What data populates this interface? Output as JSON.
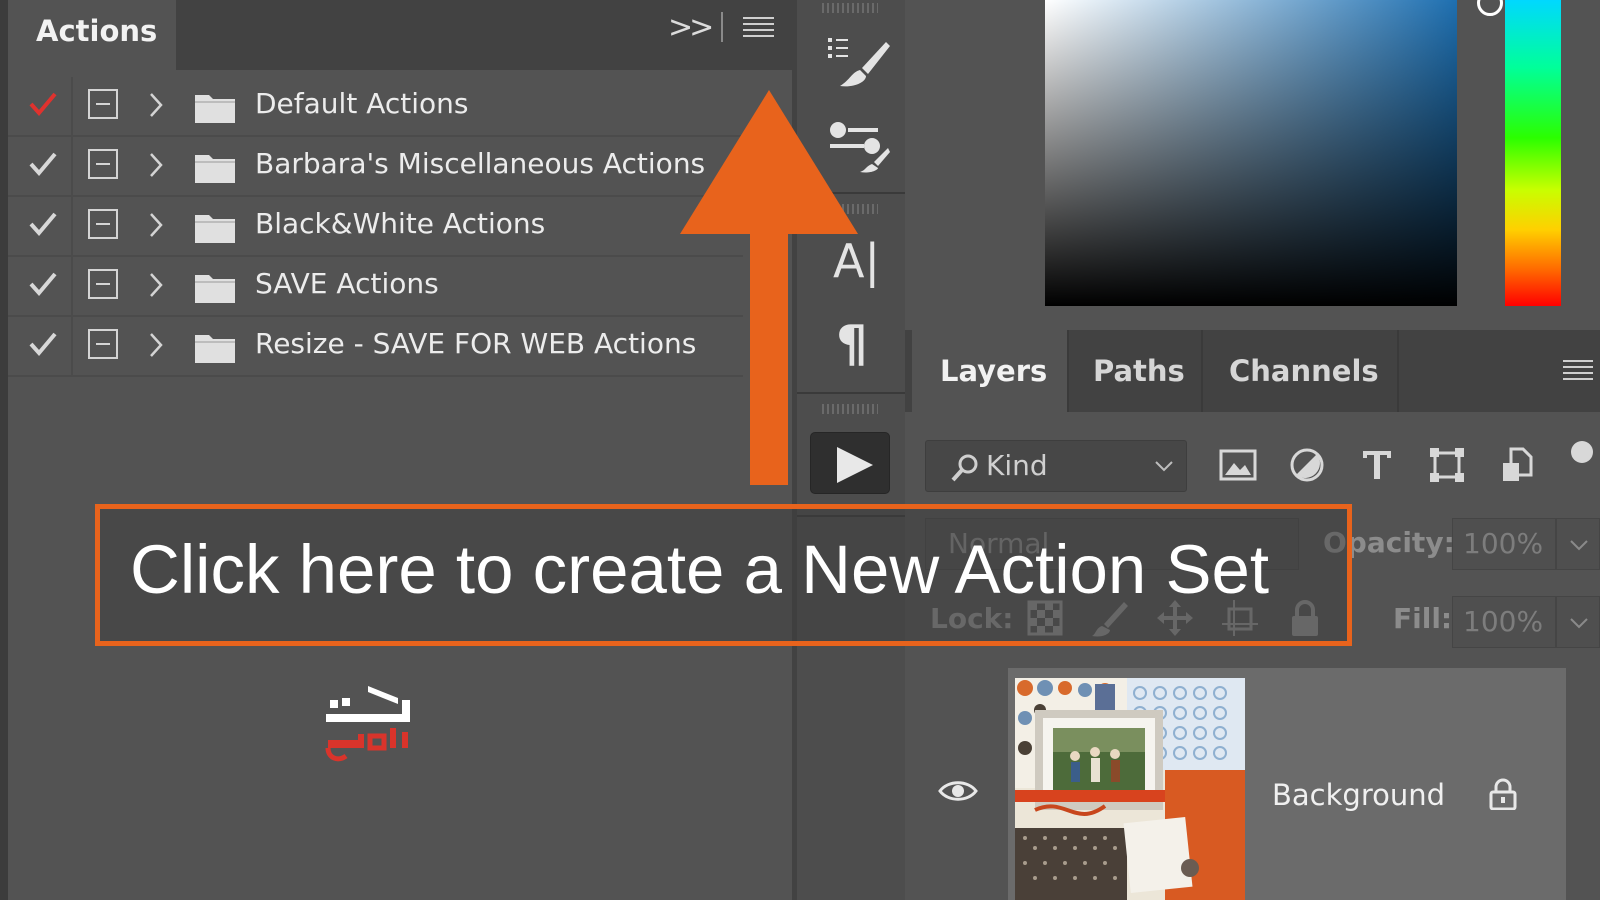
{
  "actions_panel": {
    "title": "Actions",
    "items": [
      {
        "label": "Default Actions",
        "check_color": "#e0322e"
      },
      {
        "label": "Barbara's Miscellaneous Actions",
        "check_color": "#d8d8d8"
      },
      {
        "label": "Black&White Actions",
        "check_color": "#d8d8d8"
      },
      {
        "label": "SAVE Actions",
        "check_color": "#d8d8d8"
      },
      {
        "label": "Resize - SAVE FOR WEB Actions",
        "check_color": "#d8d8d8"
      }
    ]
  },
  "tool_strip": {
    "tools": [
      "brush-settings-icon",
      "brush-presets-icon",
      "character-icon",
      "paragraph-icon",
      "play-icon"
    ],
    "character_glyph": "A|",
    "paragraph_glyph": "¶"
  },
  "color_picker": {
    "accent": "#1e6fb0"
  },
  "layers_panel": {
    "tabs": [
      {
        "label": "Layers",
        "active": true
      },
      {
        "label": "Paths",
        "active": false
      },
      {
        "label": "Channels",
        "active": false
      }
    ],
    "filter": {
      "placeholder": "Kind"
    },
    "blend_mode": "Normal",
    "opacity_label": "Opacity:",
    "opacity_value": "100%",
    "lock_label": "Lock:",
    "fill_label": "Fill:",
    "fill_value": "100%",
    "layers": [
      {
        "name": "Background",
        "visible": true,
        "locked": true
      }
    ]
  },
  "callout": {
    "text": "Click here to create a New Action Set",
    "color": "#e8631c"
  },
  "watermark": {
    "line1": "تک",
    "line2": "ادیتور"
  }
}
